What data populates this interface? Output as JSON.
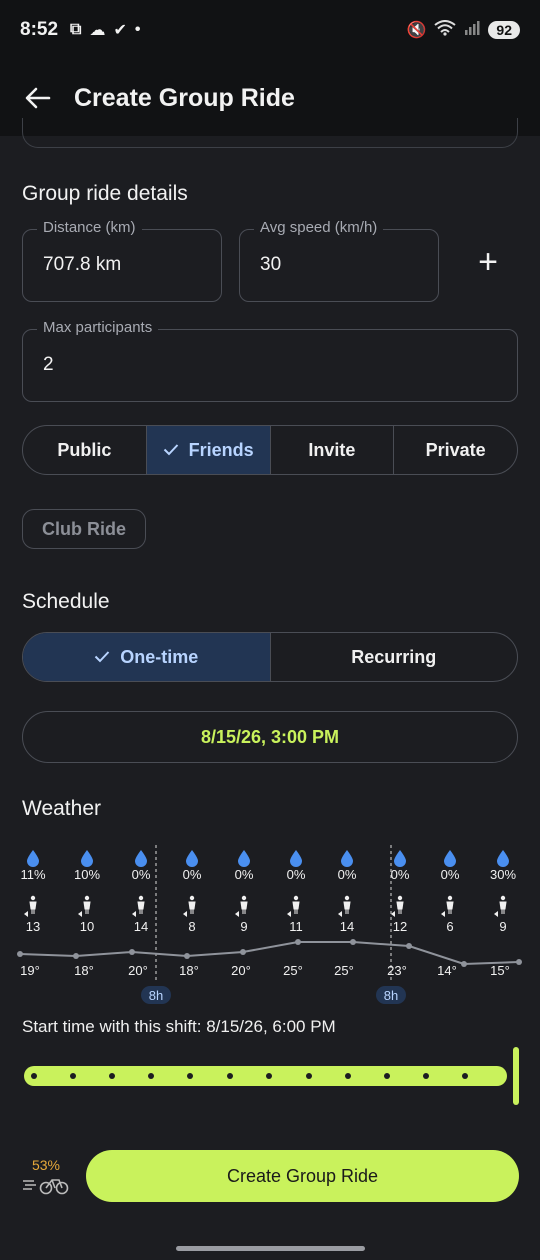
{
  "status": {
    "time": "8:52",
    "battery": "92"
  },
  "appbar": {
    "title": "Create Group Ride"
  },
  "details": {
    "title": "Group ride details",
    "distance": {
      "label": "Distance (km)",
      "value": "707.8 km"
    },
    "speed": {
      "label": "Avg speed (km/h)",
      "value": "30"
    },
    "add": "+",
    "max": {
      "label": "Max participants",
      "value": "2"
    },
    "visibility": [
      "Public",
      "Friends",
      "Invite",
      "Private"
    ],
    "visibility_selected": "Friends",
    "chip": "Club Ride"
  },
  "schedule": {
    "title": "Schedule",
    "options": [
      "One-time",
      "Recurring"
    ],
    "selected": "One-time",
    "datetime": "8/15/26, 3:00 PM"
  },
  "weather": {
    "title": "Weather",
    "precip": [
      "11%",
      "10%",
      "0%",
      "0%",
      "0%",
      "0%",
      "0%",
      "0%",
      "0%",
      "30%"
    ],
    "wind": [
      "13",
      "10",
      "14",
      "8",
      "9",
      "11",
      "14",
      "12",
      "6",
      "9"
    ],
    "temps": [
      "19°",
      "18°",
      "20°",
      "18°",
      "20°",
      "25°",
      "25°",
      "23°",
      "14°",
      "15°"
    ],
    "temp_values": [
      19,
      18,
      20,
      18,
      20,
      25,
      25,
      23,
      14,
      15
    ],
    "markers": [
      "8h",
      "8h"
    ],
    "shift_text": "Start time with this shift: 8/15/26, 6:00 PM"
  },
  "footer": {
    "percent": "53%",
    "create": "Create Group Ride"
  },
  "colors": {
    "accent": "#c9f25c",
    "selected_bg": "#223553",
    "rain": "#4a8ff0",
    "badge": "#e6a93a"
  }
}
